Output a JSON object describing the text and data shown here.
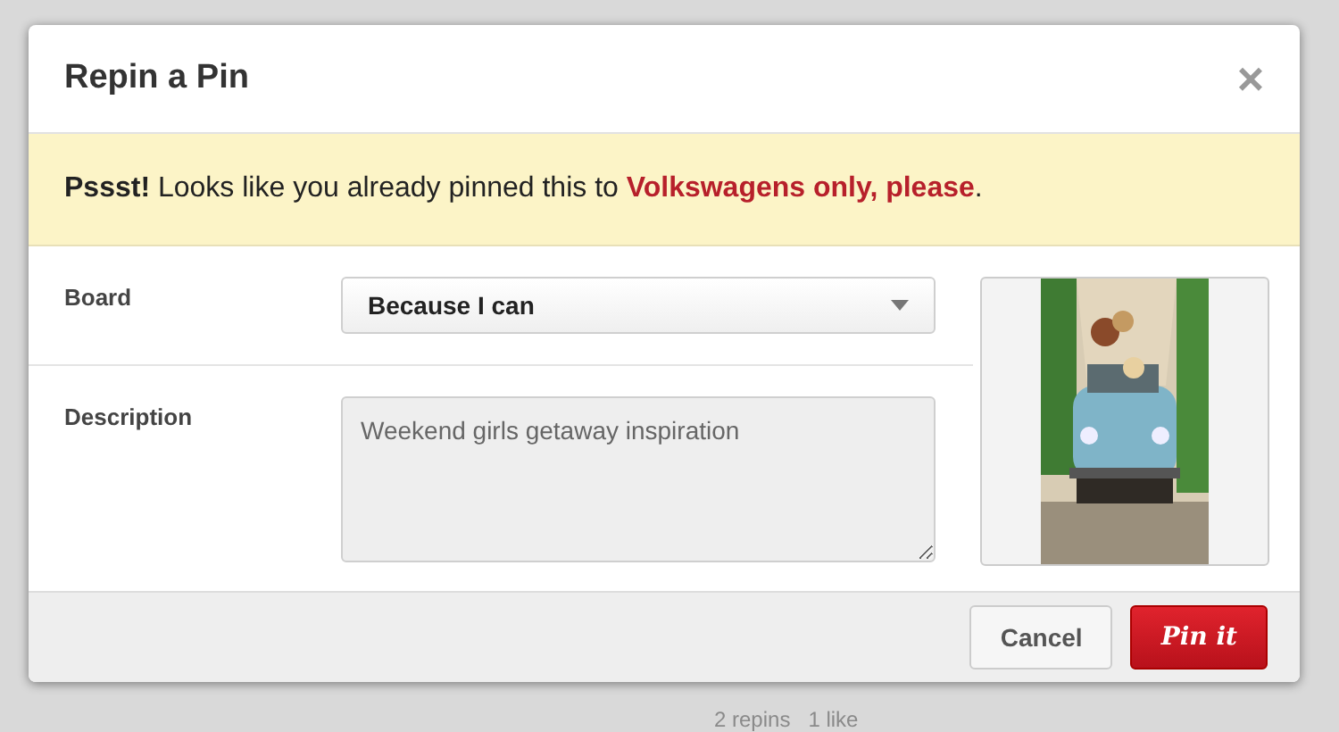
{
  "dialog": {
    "title": "Repin a Pin",
    "close": "×"
  },
  "alert": {
    "text": "**Pssst!** Looks like you already pinned this to ",
    "board": "Volkswagens only, please",
    "end": "."
  },
  "form": {
    "board": {
      "label": "Board",
      "value": "Because I can"
    },
    "description": {
      "label": "Description",
      "value": "Weekend girls getaway inspiration"
    }
  },
  "buttons": [
    {
      "label": "Cancel",
      "kind": "secondary"
    },
    {
      "label": "Pin it",
      "kind": "primary"
    }
  ],
  "background": {
    "stats": "2 repins   1 like"
  }
}
